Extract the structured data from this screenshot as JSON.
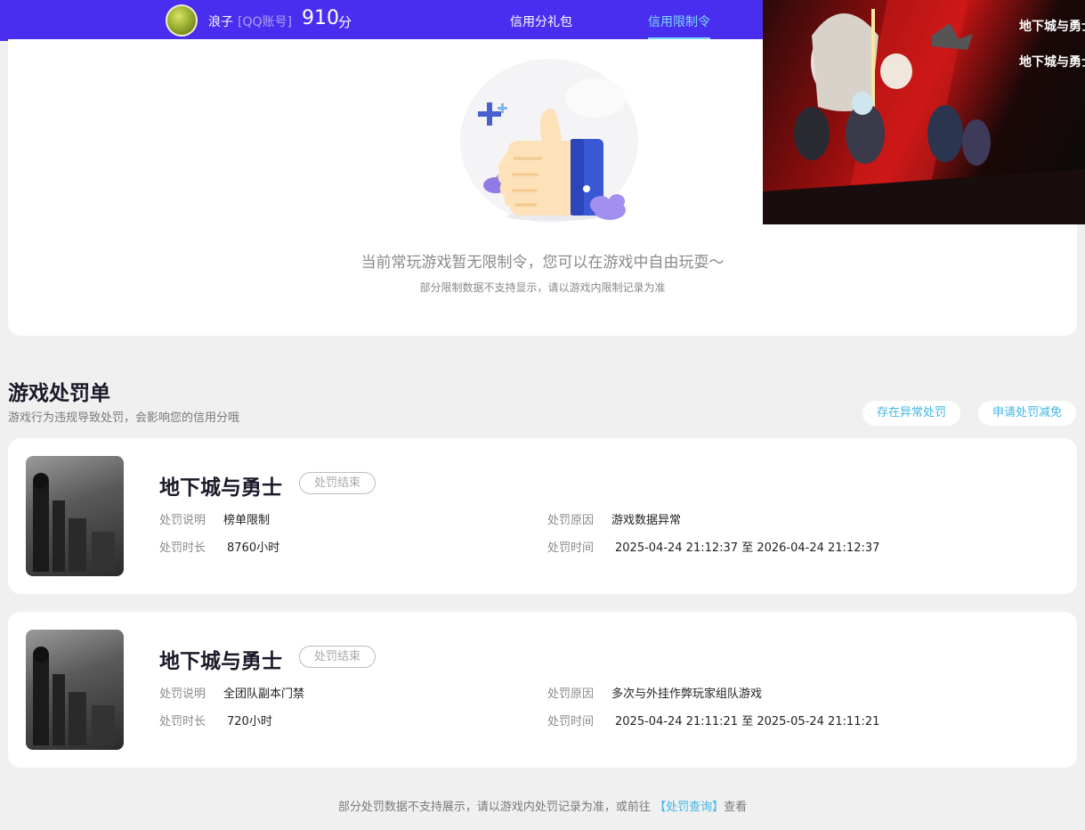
{
  "header": {
    "username": "浪子",
    "account_type": "[QQ账号]",
    "score": "910",
    "score_unit": "分",
    "tabs": [
      {
        "label": "信用分礼包",
        "active": false
      },
      {
        "label": "信用限制令",
        "active": true
      }
    ],
    "banner_logo_top": "地下城与勇士",
    "banner_logo_bottom": "地下城与勇士",
    "colors": {
      "bar": "#4a2ef0",
      "active_tab": "#7fd8ff"
    }
  },
  "empty_state": {
    "title": "当前常玩游戏暂无限制令，您可以在游戏中自由玩耍～",
    "subtitle": "部分限制数据不支持显示，请以游戏内限制记录为准",
    "icon": "thumbs-up-icon"
  },
  "penalties": {
    "title": "游戏处罚单",
    "subtitle": "游戏行为违规导致处罚，会影响您的信用分哦",
    "abnormal_button": "存在异常处罚",
    "appeal_button": "申请处罚减免",
    "labels": {
      "desc": "处罚说明",
      "duration": "处罚时长",
      "reason": "处罚原因",
      "time": "处罚时间"
    },
    "items": [
      {
        "game": "地下城与勇士",
        "status": "处罚结束",
        "desc": "榜单限制",
        "duration": "8760小时",
        "reason": "游戏数据异常",
        "time": "2025-04-24 21:12:37 至 2026-04-24 21:12:37"
      },
      {
        "game": "地下城与勇士",
        "status": "处罚结束",
        "desc": "全团队副本门禁",
        "duration": "720小时",
        "reason": "多次与外挂作弊玩家组队游戏",
        "time": "2025-04-24 21:11:21 至 2025-05-24 21:11:21"
      }
    ]
  },
  "footer": {
    "text_before": "部分处罚数据不支持展示，请以游戏内处罚记录为准，或前往",
    "link": "【处罚查询】",
    "text_after": "查看"
  }
}
